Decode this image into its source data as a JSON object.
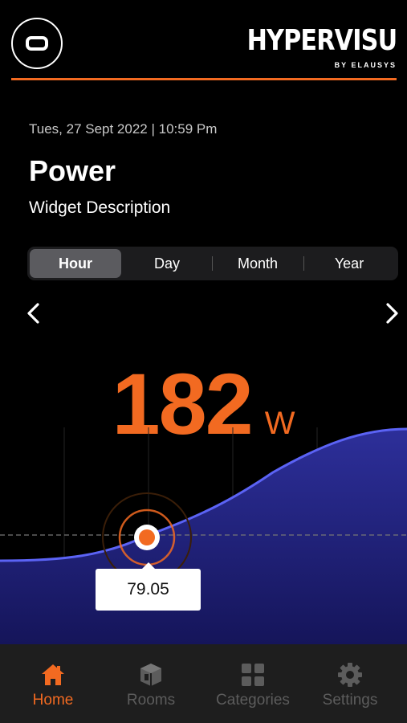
{
  "header": {
    "brand": "HYPERVISU",
    "brand_sub": "BY ELAUSYS",
    "accent": "#f26a21"
  },
  "widget": {
    "date": "Tues, 27 Sept 2022 | 10:59 Pm",
    "title": "Power",
    "description": "Widget Description"
  },
  "tabs": [
    {
      "label": "Hour",
      "active": true
    },
    {
      "label": "Day",
      "active": false
    },
    {
      "label": "Month",
      "active": false
    },
    {
      "label": "Year",
      "active": false
    }
  ],
  "reading": {
    "value": "182",
    "unit": "W"
  },
  "chart": {
    "tooltip_value": "79.05",
    "line_color": "#5b63f5",
    "fill_color": "#1e1e6e"
  },
  "nav": [
    {
      "label": "Home",
      "icon": "home-icon",
      "active": true
    },
    {
      "label": "Rooms",
      "icon": "rooms-icon",
      "active": false
    },
    {
      "label": "Categories",
      "icon": "categories-icon",
      "active": false
    },
    {
      "label": "Settings",
      "icon": "settings-icon",
      "active": false
    }
  ]
}
